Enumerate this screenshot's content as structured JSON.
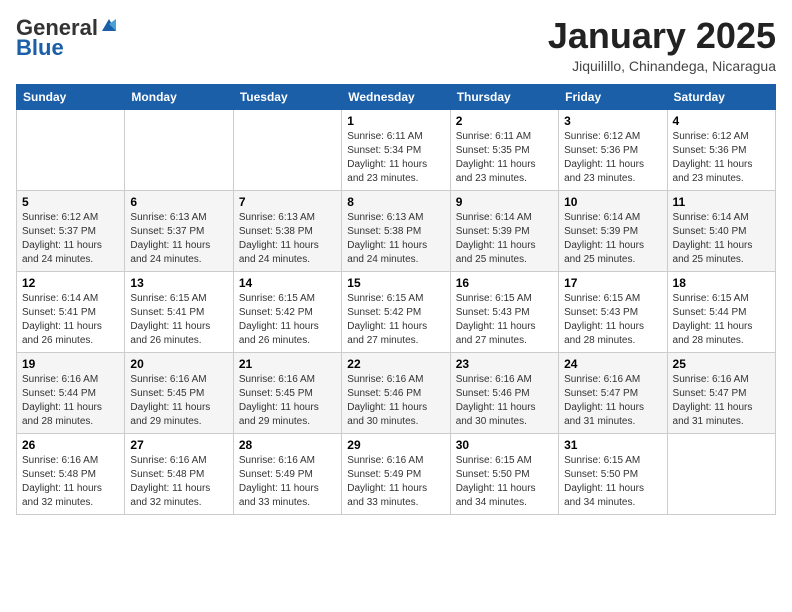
{
  "header": {
    "logo_general": "General",
    "logo_blue": "Blue",
    "month_title": "January 2025",
    "location": "Jiquilillo, Chinandega, Nicaragua"
  },
  "calendar": {
    "days_of_week": [
      "Sunday",
      "Monday",
      "Tuesday",
      "Wednesday",
      "Thursday",
      "Friday",
      "Saturday"
    ],
    "weeks": [
      [
        {
          "day": "",
          "info": ""
        },
        {
          "day": "",
          "info": ""
        },
        {
          "day": "",
          "info": ""
        },
        {
          "day": "1",
          "info": "Sunrise: 6:11 AM\nSunset: 5:34 PM\nDaylight: 11 hours\nand 23 minutes."
        },
        {
          "day": "2",
          "info": "Sunrise: 6:11 AM\nSunset: 5:35 PM\nDaylight: 11 hours\nand 23 minutes."
        },
        {
          "day": "3",
          "info": "Sunrise: 6:12 AM\nSunset: 5:36 PM\nDaylight: 11 hours\nand 23 minutes."
        },
        {
          "day": "4",
          "info": "Sunrise: 6:12 AM\nSunset: 5:36 PM\nDaylight: 11 hours\nand 23 minutes."
        }
      ],
      [
        {
          "day": "5",
          "info": "Sunrise: 6:12 AM\nSunset: 5:37 PM\nDaylight: 11 hours\nand 24 minutes."
        },
        {
          "day": "6",
          "info": "Sunrise: 6:13 AM\nSunset: 5:37 PM\nDaylight: 11 hours\nand 24 minutes."
        },
        {
          "day": "7",
          "info": "Sunrise: 6:13 AM\nSunset: 5:38 PM\nDaylight: 11 hours\nand 24 minutes."
        },
        {
          "day": "8",
          "info": "Sunrise: 6:13 AM\nSunset: 5:38 PM\nDaylight: 11 hours\nand 24 minutes."
        },
        {
          "day": "9",
          "info": "Sunrise: 6:14 AM\nSunset: 5:39 PM\nDaylight: 11 hours\nand 25 minutes."
        },
        {
          "day": "10",
          "info": "Sunrise: 6:14 AM\nSunset: 5:39 PM\nDaylight: 11 hours\nand 25 minutes."
        },
        {
          "day": "11",
          "info": "Sunrise: 6:14 AM\nSunset: 5:40 PM\nDaylight: 11 hours\nand 25 minutes."
        }
      ],
      [
        {
          "day": "12",
          "info": "Sunrise: 6:14 AM\nSunset: 5:41 PM\nDaylight: 11 hours\nand 26 minutes."
        },
        {
          "day": "13",
          "info": "Sunrise: 6:15 AM\nSunset: 5:41 PM\nDaylight: 11 hours\nand 26 minutes."
        },
        {
          "day": "14",
          "info": "Sunrise: 6:15 AM\nSunset: 5:42 PM\nDaylight: 11 hours\nand 26 minutes."
        },
        {
          "day": "15",
          "info": "Sunrise: 6:15 AM\nSunset: 5:42 PM\nDaylight: 11 hours\nand 27 minutes."
        },
        {
          "day": "16",
          "info": "Sunrise: 6:15 AM\nSunset: 5:43 PM\nDaylight: 11 hours\nand 27 minutes."
        },
        {
          "day": "17",
          "info": "Sunrise: 6:15 AM\nSunset: 5:43 PM\nDaylight: 11 hours\nand 28 minutes."
        },
        {
          "day": "18",
          "info": "Sunrise: 6:15 AM\nSunset: 5:44 PM\nDaylight: 11 hours\nand 28 minutes."
        }
      ],
      [
        {
          "day": "19",
          "info": "Sunrise: 6:16 AM\nSunset: 5:44 PM\nDaylight: 11 hours\nand 28 minutes."
        },
        {
          "day": "20",
          "info": "Sunrise: 6:16 AM\nSunset: 5:45 PM\nDaylight: 11 hours\nand 29 minutes."
        },
        {
          "day": "21",
          "info": "Sunrise: 6:16 AM\nSunset: 5:45 PM\nDaylight: 11 hours\nand 29 minutes."
        },
        {
          "day": "22",
          "info": "Sunrise: 6:16 AM\nSunset: 5:46 PM\nDaylight: 11 hours\nand 30 minutes."
        },
        {
          "day": "23",
          "info": "Sunrise: 6:16 AM\nSunset: 5:46 PM\nDaylight: 11 hours\nand 30 minutes."
        },
        {
          "day": "24",
          "info": "Sunrise: 6:16 AM\nSunset: 5:47 PM\nDaylight: 11 hours\nand 31 minutes."
        },
        {
          "day": "25",
          "info": "Sunrise: 6:16 AM\nSunset: 5:47 PM\nDaylight: 11 hours\nand 31 minutes."
        }
      ],
      [
        {
          "day": "26",
          "info": "Sunrise: 6:16 AM\nSunset: 5:48 PM\nDaylight: 11 hours\nand 32 minutes."
        },
        {
          "day": "27",
          "info": "Sunrise: 6:16 AM\nSunset: 5:48 PM\nDaylight: 11 hours\nand 32 minutes."
        },
        {
          "day": "28",
          "info": "Sunrise: 6:16 AM\nSunset: 5:49 PM\nDaylight: 11 hours\nand 33 minutes."
        },
        {
          "day": "29",
          "info": "Sunrise: 6:16 AM\nSunset: 5:49 PM\nDaylight: 11 hours\nand 33 minutes."
        },
        {
          "day": "30",
          "info": "Sunrise: 6:15 AM\nSunset: 5:50 PM\nDaylight: 11 hours\nand 34 minutes."
        },
        {
          "day": "31",
          "info": "Sunrise: 6:15 AM\nSunset: 5:50 PM\nDaylight: 11 hours\nand 34 minutes."
        },
        {
          "day": "",
          "info": ""
        }
      ]
    ]
  }
}
